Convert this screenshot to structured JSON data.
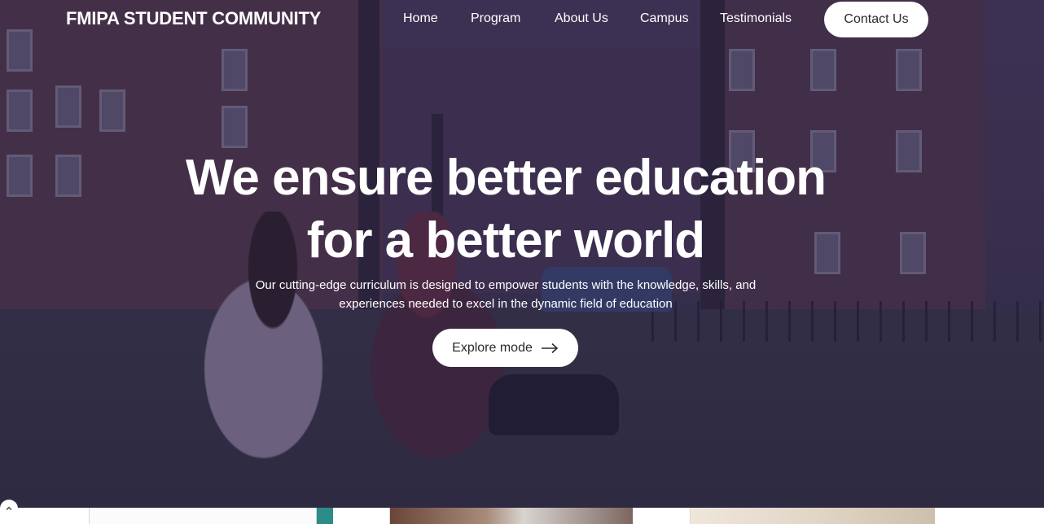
{
  "brand": "FMIPA STUDENT COMMUNITY",
  "nav": {
    "items": [
      {
        "label": "Home"
      },
      {
        "label": "Program"
      },
      {
        "label": "About Us"
      },
      {
        "label": "Campus"
      },
      {
        "label": "Testimonials"
      }
    ],
    "contact_label": "Contact Us"
  },
  "hero": {
    "title_line1": "We ensure better education",
    "title_line2": "for a better world",
    "subtitle_line1": "Our cutting-edge curriculum is designed to empower students with the knowledge, skills, and",
    "subtitle_line2": "experiences needed to excel in the dynamic field of education",
    "cta_label": "Explore mode",
    "cta_icon": "arrow-right-icon"
  },
  "colors": {
    "overlay": "#261e46",
    "button_bg": "#ffffff",
    "text_light": "#ffffff",
    "text_dark": "#2b2b2b"
  }
}
